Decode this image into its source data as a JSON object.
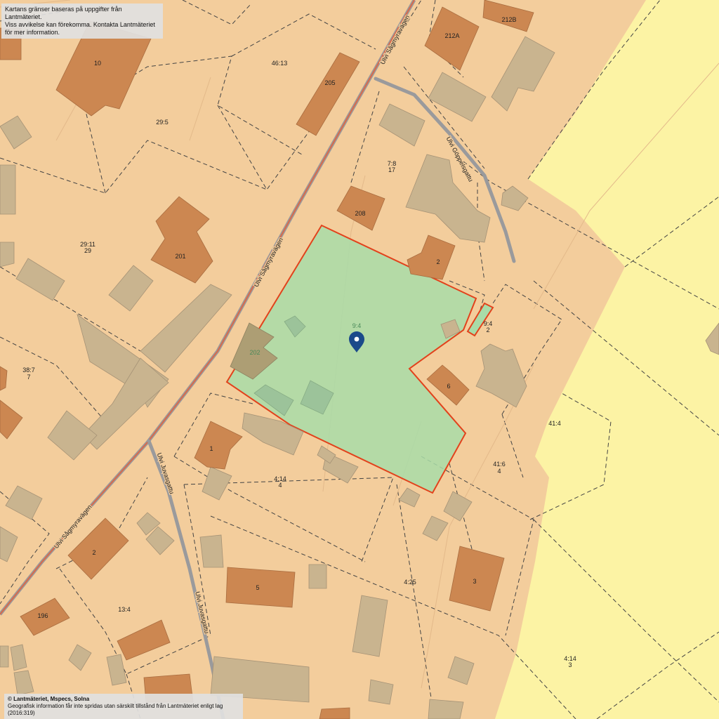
{
  "disclaimer": {
    "line1": "Kartans gränser baseras på uppgifter från Lantmäteriet.",
    "line2": "Viss avvikelse kan förekomma. Kontakta Lantmäteriet för mer information."
  },
  "copyright": {
    "line1": "© Lantmäteriet, Mspecs, Solna",
    "line2": "Geografisk information får inte spridas utan särskilt tillstånd från Lantmäteriet enligt lag (2016:319)"
  },
  "colors": {
    "land": "#f3cd9c",
    "field": "#fcf3a4",
    "house": "#cc8751",
    "outbuilding": "#c9b48f",
    "selected_fill": "#a8dca8",
    "selected_border": "#e2421c",
    "main_road": "#d86a4a",
    "footpath": "#9a9a9c",
    "pin": "#1b4a8a"
  },
  "streets": {
    "sagmyra_upper": "Ulvi Sågmyravägen",
    "sagmyra_mid": "Ulvi Sågmyravägen",
    "sagmyra_lower": "Ulvi Sågmyravägen",
    "goppels": "Ulvi Göppelsgattu",
    "juvas": "Ulvi Juvasgattu",
    "juvas_lower": "Ulvi Juvasgattu"
  },
  "parcels": {
    "p46_13": "46:13",
    "p29_5": "29:5",
    "p29_11": "29:11",
    "p29_11_b": "29",
    "p38_7": "38:7",
    "p38_7_b": "7",
    "p7_8": "7:8",
    "p7_8_b": "17",
    "p9_4_main": "9:4",
    "p9_4_small": "9:4",
    "p9_4_small_b": "2",
    "p41_4": "41:4",
    "p41_6": "41:6",
    "p41_6_b": "4",
    "p4_14": "4:14",
    "p4_14_b": "4",
    "p4_25": "4:25",
    "p13_4": "13:4",
    "p4_14_east": "4:14",
    "p4_14_east_b": "3"
  },
  "houses": {
    "h10": "10",
    "h205": "205",
    "h212A": "212A",
    "h212B": "212B",
    "h208": "208",
    "h201": "201",
    "h2_top": "2",
    "h202": "202",
    "h6": "6",
    "h1": "1",
    "h2_left": "2",
    "h5": "5",
    "h3": "3",
    "h196": "196"
  },
  "pin": {
    "icon": "map-marker-icon"
  }
}
